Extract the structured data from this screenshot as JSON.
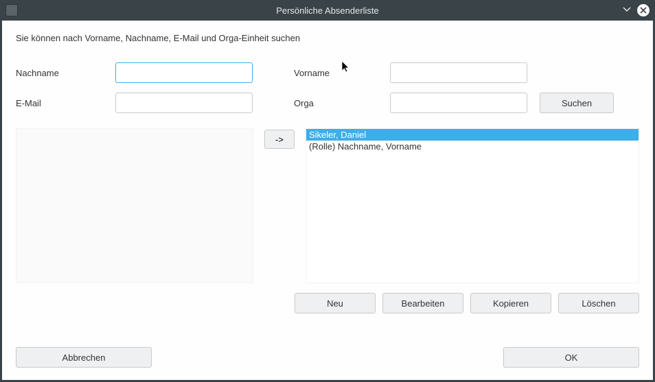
{
  "window": {
    "title": "Persönliche Absenderliste"
  },
  "help_text": "Sie können nach Vorname, Nachname, E-Mail und Orga-Einheit suchen",
  "labels": {
    "nachname": "Nachname",
    "vorname": "Vorname",
    "email": "E-Mail",
    "orga": "Orga"
  },
  "inputs": {
    "nachname": "",
    "vorname": "",
    "email": "",
    "orga": ""
  },
  "buttons": {
    "search": "Suchen",
    "arrow": "->",
    "neu": "Neu",
    "bearbeiten": "Bearbeiten",
    "kopieren": "Kopieren",
    "loeschen": "Löschen",
    "abbrechen": "Abbrechen",
    "ok": "OK"
  },
  "left_list": {
    "items": []
  },
  "right_list": {
    "items": [
      {
        "label": "Sikeler, Daniel",
        "selected": true
      },
      {
        "label": "(Rolle) Nachname, Vorname",
        "selected": false
      }
    ]
  }
}
